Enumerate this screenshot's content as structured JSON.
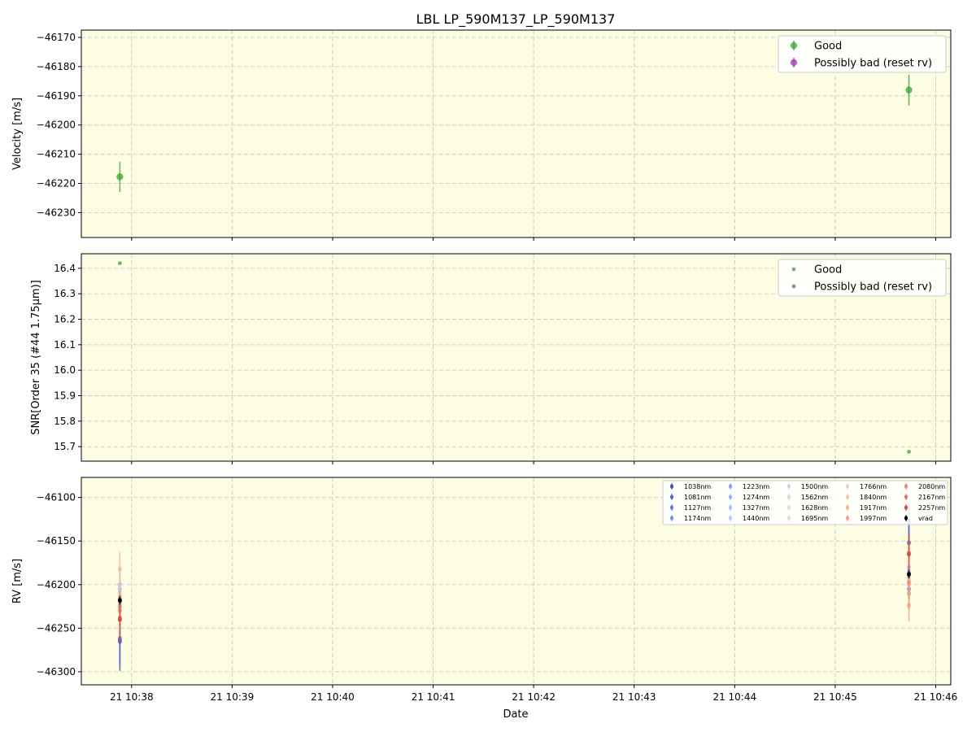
{
  "title": "LBL LP_590M137_LP_590M137",
  "colors": {
    "panel_bg": "#fdfde3",
    "good": "#2ca02c",
    "bad": "#9b30a6",
    "grid": "#c9c9c9",
    "vrad": "#000000"
  },
  "chart_data": [
    {
      "type": "scatter",
      "ylabel": "Velocity [m/s]",
      "xlabel": "",
      "ylim": [
        -46238.5,
        -46167.5
      ],
      "yticks": [
        -46170,
        -46180,
        -46190,
        -46200,
        -46210,
        -46220,
        -46230
      ],
      "yticklabels": [
        "−46170",
        "−46180",
        "−46190",
        "−46200",
        "−46210",
        "−46220",
        "−46230"
      ],
      "grid": true,
      "legend_position": "top-right",
      "legend": [
        "Good",
        "Possibly bad (reset rv)"
      ],
      "series": [
        {
          "name": "Good",
          "points": [
            {
              "x": "10:37:53",
              "y": -46217.7,
              "err": 5.2
            },
            {
              "x": "10:45:44",
              "y": -46188.0,
              "err": 5.3
            }
          ]
        },
        {
          "name": "Possibly bad (reset rv)",
          "points": []
        }
      ]
    },
    {
      "type": "scatter",
      "ylabel": "SNR[Order 35 (#44 1.75μm)]",
      "xlabel": "",
      "ylim": [
        15.643,
        16.457
      ],
      "yticks": [
        16.4,
        16.3,
        16.2,
        16.1,
        16.0,
        15.9,
        15.8,
        15.7
      ],
      "yticklabels": [
        "16.4",
        "16.3",
        "16.2",
        "16.1",
        "16.0",
        "15.9",
        "15.8",
        "15.7"
      ],
      "grid": true,
      "legend_position": "top-right",
      "legend": [
        "Good",
        "Possibly bad (reset rv)"
      ],
      "series": [
        {
          "name": "Good",
          "points": [
            {
              "x": "10:37:53",
              "y": 16.42
            },
            {
              "x": "10:45:44",
              "y": 15.68
            }
          ]
        },
        {
          "name": "Possibly bad (reset rv)",
          "points": []
        }
      ]
    },
    {
      "type": "scatter",
      "ylabel": "RV [m/s]",
      "xlabel": "Date",
      "ylim": [
        -46315,
        -46077
      ],
      "yticks": [
        -46100,
        -46150,
        -46200,
        -46250,
        -46300
      ],
      "yticklabels": [
        "−46100",
        "−46150",
        "−46200",
        "−46250",
        "−46300"
      ],
      "grid": true,
      "legend_position": "top-right",
      "legend": [
        "1038nm",
        "1081nm",
        "1127nm",
        "1174nm",
        "1223nm",
        "1274nm",
        "1327nm",
        "1440nm",
        "1500nm",
        "1562nm",
        "1628nm",
        "1695nm",
        "1766nm",
        "1840nm",
        "1917nm",
        "1997nm",
        "2080nm",
        "2167nm",
        "2257nm",
        "vrad"
      ],
      "series": [
        {
          "name": "1038nm",
          "color": "#3b4cc0",
          "points": [
            {
              "x": "10:37:53",
              "y": -46265,
              "err": 34
            },
            {
              "x": "10:45:44",
              "y": -46128,
              "err": 22
            }
          ]
        },
        {
          "name": "1081nm",
          "color": "#4a63d3",
          "points": [
            {
              "x": "10:37:53",
              "y": -46262,
              "err": 30
            },
            {
              "x": "10:45:44",
              "y": -46152,
              "err": 20
            }
          ]
        },
        {
          "name": "1127nm",
          "color": "#5b7ae5",
          "points": [
            {
              "x": "10:37:53",
              "y": -46240,
              "err": 26
            },
            {
              "x": "10:45:44",
              "y": -46210,
              "err": 18
            }
          ]
        },
        {
          "name": "1174nm",
          "color": "#6c8ff1",
          "points": [
            {
              "x": "10:37:53",
              "y": -46225,
              "err": 22
            },
            {
              "x": "10:45:44",
              "y": -46205,
              "err": 16
            }
          ]
        },
        {
          "name": "1223nm",
          "color": "#7ea1fa",
          "points": [
            {
              "x": "10:37:53",
              "y": -46220,
              "err": 20
            },
            {
              "x": "10:45:44",
              "y": -46185,
              "err": 15
            }
          ]
        },
        {
          "name": "1274nm",
          "color": "#90b2fe",
          "points": [
            {
              "x": "10:37:53",
              "y": -46205,
              "err": 18
            },
            {
              "x": "10:45:44",
              "y": -46195,
              "err": 14
            }
          ]
        },
        {
          "name": "1327nm",
          "color": "#a3c2fe",
          "points": [
            {
              "x": "10:37:53",
              "y": -46200,
              "err": 18
            },
            {
              "x": "10:45:44",
              "y": -46180,
              "err": 14
            }
          ]
        },
        {
          "name": "1440nm",
          "color": "#b5cdfa",
          "points": [
            {
              "x": "10:37:53",
              "y": -46215,
              "err": 16
            },
            {
              "x": "10:45:44",
              "y": -46192,
              "err": 12
            }
          ]
        },
        {
          "name": "1500nm",
          "color": "#c6d6f1",
          "points": [
            {
              "x": "10:37:53",
              "y": -46210,
              "err": 16
            },
            {
              "x": "10:45:44",
              "y": -46188,
              "err": 12
            }
          ]
        },
        {
          "name": "1562nm",
          "color": "#d5dbe5",
          "points": [
            {
              "x": "10:37:53",
              "y": -46222,
              "err": 16
            },
            {
              "x": "10:45:44",
              "y": -46186,
              "err": 12
            }
          ]
        },
        {
          "name": "1628nm",
          "color": "#e2dad5",
          "points": [
            {
              "x": "10:37:53",
              "y": -46212,
              "err": 16
            },
            {
              "x": "10:45:44",
              "y": -46190,
              "err": 12
            }
          ]
        },
        {
          "name": "1695nm",
          "color": "#dddcdc",
          "points": [
            {
              "x": "10:37:53",
              "y": -46218,
              "err": 16
            },
            {
              "x": "10:45:44",
              "y": -46183,
              "err": 12
            }
          ]
        },
        {
          "name": "1766nm",
          "color": "#edd1c2",
          "points": [
            {
              "x": "10:37:53",
              "y": -46208,
              "err": 18
            },
            {
              "x": "10:45:44",
              "y": -46195,
              "err": 14
            }
          ]
        },
        {
          "name": "1840nm",
          "color": "#f4c5ad",
          "points": [
            {
              "x": "10:37:53",
              "y": -46214,
              "err": 18
            },
            {
              "x": "10:45:44",
              "y": -46200,
              "err": 14
            }
          ]
        },
        {
          "name": "1917nm",
          "color": "#f7b89c",
          "points": [
            {
              "x": "10:37:53",
              "y": -46182,
              "err": 20
            },
            {
              "x": "10:45:44",
              "y": -46210,
              "err": 16
            }
          ]
        },
        {
          "name": "1997nm",
          "color": "#f6a385",
          "points": [
            {
              "x": "10:37:53",
              "y": -46225,
              "err": 20
            },
            {
              "x": "10:45:44",
              "y": -46224,
              "err": 18
            }
          ]
        },
        {
          "name": "2080nm",
          "color": "#f08b6e",
          "points": [
            {
              "x": "10:37:53",
              "y": -46230,
              "err": 22
            },
            {
              "x": "10:45:44",
              "y": -46198,
              "err": 18
            }
          ]
        },
        {
          "name": "2167nm",
          "color": "#e5705a",
          "points": [
            {
              "x": "10:37:53",
              "y": -46238,
              "err": 24
            },
            {
              "x": "10:45:44",
              "y": -46164,
              "err": 20
            }
          ]
        },
        {
          "name": "2257nm",
          "color": "#d24b40",
          "points": [
            {
              "x": "10:37:53",
              "y": -46240,
              "err": 26
            },
            {
              "x": "10:45:44",
              "y": -46165,
              "err": 22
            }
          ]
        },
        {
          "name": "vrad",
          "color": "#000000",
          "points": [
            {
              "x": "10:37:53",
              "y": -46218,
              "err": 5
            },
            {
              "x": "10:45:44",
              "y": -46188,
              "err": 5
            }
          ]
        }
      ]
    }
  ],
  "xaxis": {
    "xlabel": "Date",
    "xlim": [
      "10:37:30",
      "10:46:09"
    ],
    "ticks": [
      "10:38:00",
      "10:39:00",
      "10:40:00",
      "10:41:00",
      "10:42:00",
      "10:43:00",
      "10:44:00",
      "10:45:00",
      "10:46:00"
    ],
    "ticklabels": [
      "21 10:38",
      "21 10:39",
      "21 10:40",
      "21 10:41",
      "21 10:42",
      "21 10:43",
      "21 10:44",
      "21 10:45",
      "21 10:46"
    ]
  }
}
